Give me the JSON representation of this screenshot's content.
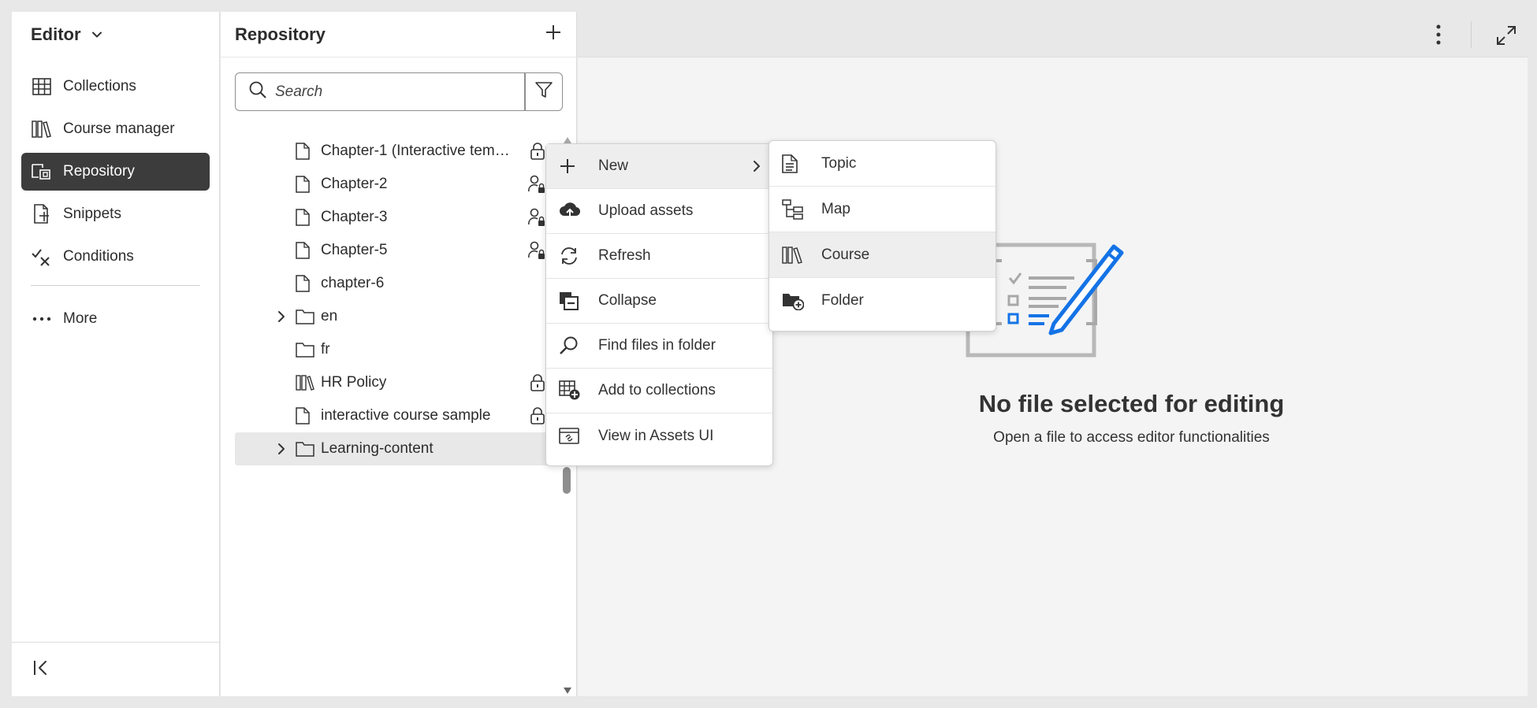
{
  "leftnav": {
    "title": "Editor",
    "items": [
      {
        "label": "Collections"
      },
      {
        "label": "Course manager"
      },
      {
        "label": "Repository"
      },
      {
        "label": "Snippets"
      },
      {
        "label": "Conditions"
      }
    ],
    "more_label": "More"
  },
  "repo": {
    "title": "Repository",
    "search_placeholder": "Search",
    "tree": [
      {
        "label": "Chapter-1 (Interactive temp...",
        "type": "file",
        "status": "lock"
      },
      {
        "label": "Chapter-2",
        "type": "file",
        "status": "user-lock"
      },
      {
        "label": "Chapter-3",
        "type": "file",
        "status": "user-lock"
      },
      {
        "label": "Chapter-5",
        "type": "file",
        "status": "user-lock"
      },
      {
        "label": "chapter-6",
        "type": "file",
        "status": ""
      },
      {
        "label": "en",
        "type": "folder",
        "status": ""
      },
      {
        "label": "fr",
        "type": "folder",
        "status": ""
      },
      {
        "label": "HR Policy",
        "type": "course",
        "status": "lock"
      },
      {
        "label": "interactive course sample",
        "type": "file",
        "status": "lock"
      },
      {
        "label": "Learning-content",
        "type": "folder",
        "status": ""
      }
    ]
  },
  "context_menu": {
    "items": [
      {
        "label": "New"
      },
      {
        "label": "Upload assets"
      },
      {
        "label": "Refresh"
      },
      {
        "label": "Collapse"
      },
      {
        "label": "Find files in folder"
      },
      {
        "label": "Add to collections"
      },
      {
        "label": "View in Assets UI"
      }
    ]
  },
  "submenu": {
    "items": [
      {
        "label": "Topic"
      },
      {
        "label": "Map"
      },
      {
        "label": "Course"
      },
      {
        "label": "Folder"
      }
    ]
  },
  "main": {
    "empty_title": "No file selected for editing",
    "empty_subtitle": "Open a file to access editor functionalities"
  },
  "colors": {
    "accent": "#1473e6",
    "active_nav": "#3c3c3c"
  }
}
